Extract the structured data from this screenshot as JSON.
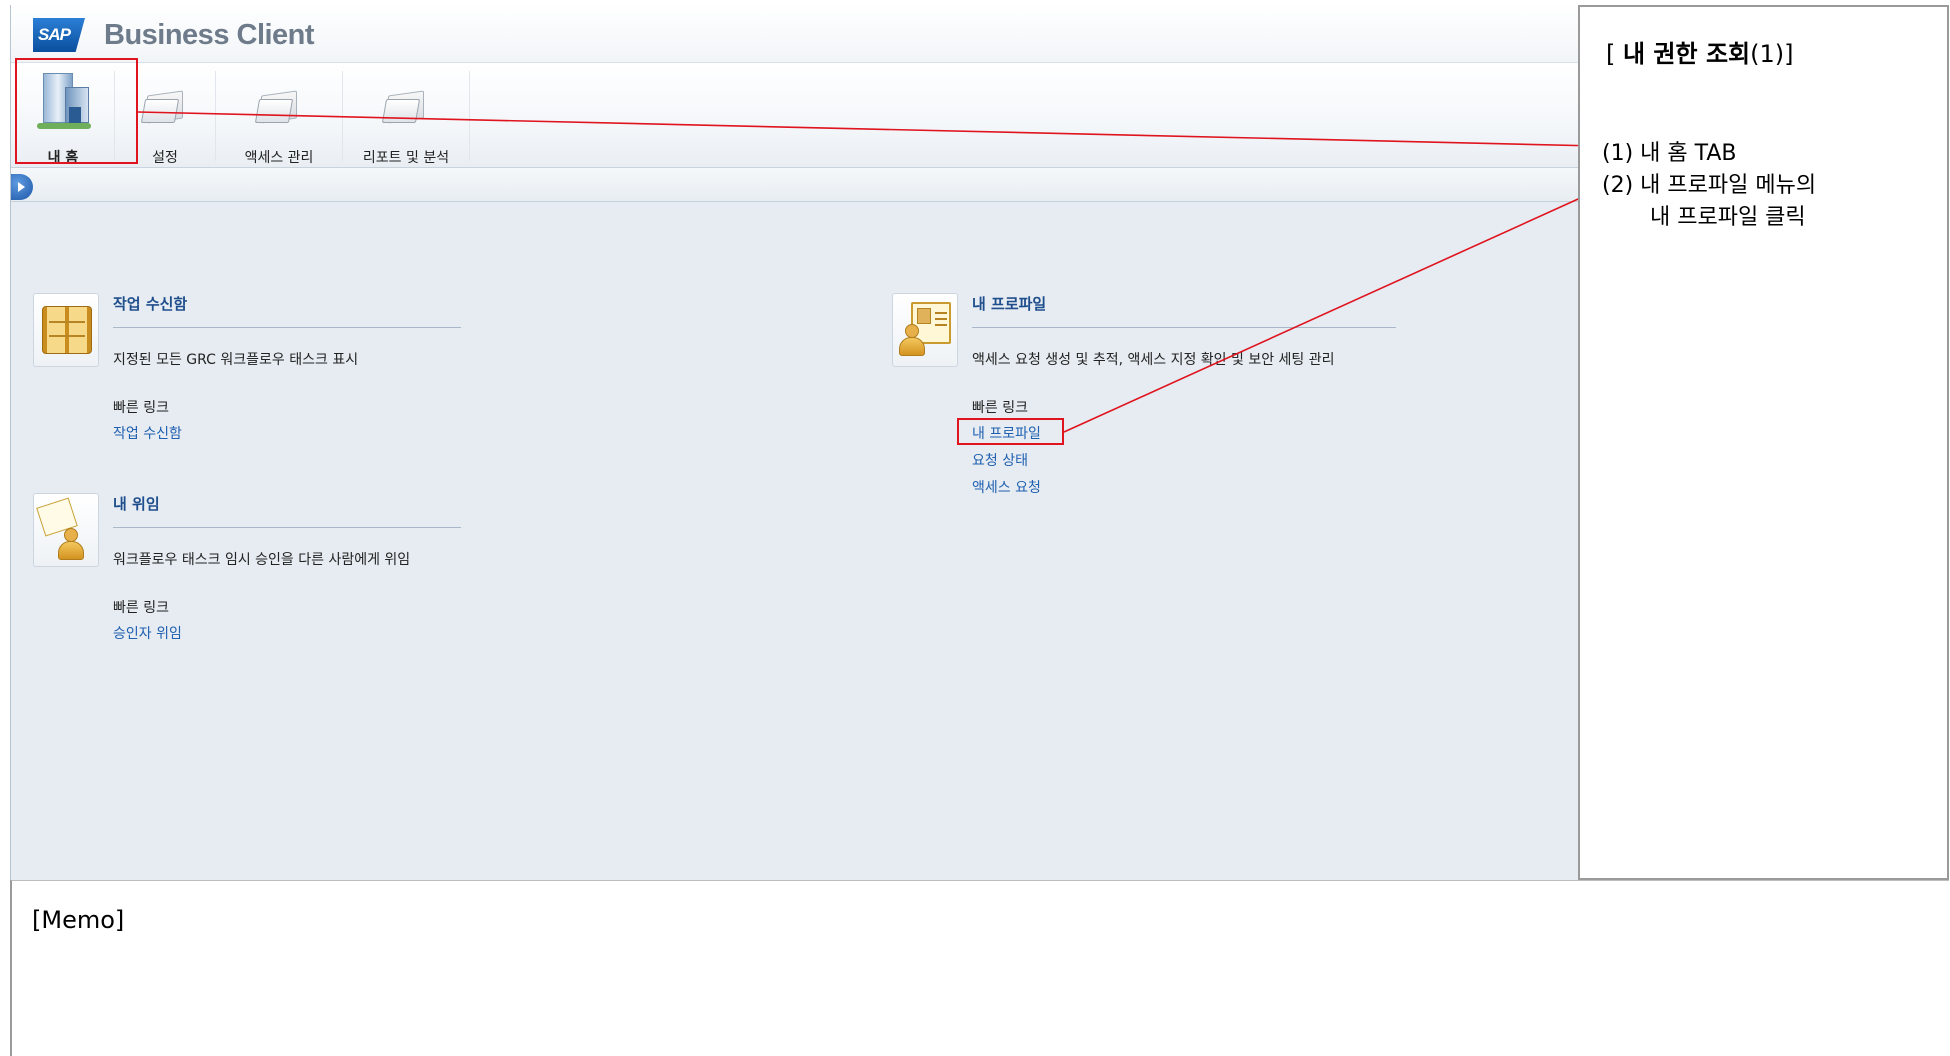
{
  "app": {
    "logo": "SAP",
    "title": "Business Client"
  },
  "tabs": [
    {
      "label": "내 홈",
      "icon": "building-icon",
      "active": true
    },
    {
      "label": "설정",
      "icon": "folder-icon",
      "active": false
    },
    {
      "label": "액세스 관리",
      "icon": "folder-icon",
      "active": false
    },
    {
      "label": "리포트 및 분석",
      "icon": "folder-icon",
      "active": false
    }
  ],
  "panels": {
    "inbox": {
      "title": "작업 수신함",
      "description": "지정된 모든 GRC 워크플로우 태스크 표시",
      "quick_title": "빠른 링크",
      "links": [
        "작업 수신함"
      ]
    },
    "delegation": {
      "title": "내 위임",
      "description": "워크플로우 태스크 임시 승인을 다른 사람에게 위임",
      "quick_title": "빠른 링크",
      "links": [
        "승인자 위임"
      ]
    },
    "profile": {
      "title": "내 프로파일",
      "description": "액세스 요청 생성 및 추적, 액세스 지정 확인 및 보안 세팅 관리",
      "quick_title": "빠른 링크",
      "links": [
        "내 프로파일",
        "요청 상태",
        "액세스 요청"
      ]
    }
  },
  "side": {
    "title_prefix": "[ ",
    "title_bold": "내 권한 조회",
    "title_suffix": "(1)]",
    "step1": "(1) 내 홈 TAB",
    "step2": "(2) 내 프로파일 메뉴의",
    "step2b": "내 프로파일 클릭"
  },
  "memo": {
    "label": "[Memo]"
  },
  "colors": {
    "annotation": "#e0141e",
    "link": "#2060b0",
    "title": "#1f4e8c"
  }
}
